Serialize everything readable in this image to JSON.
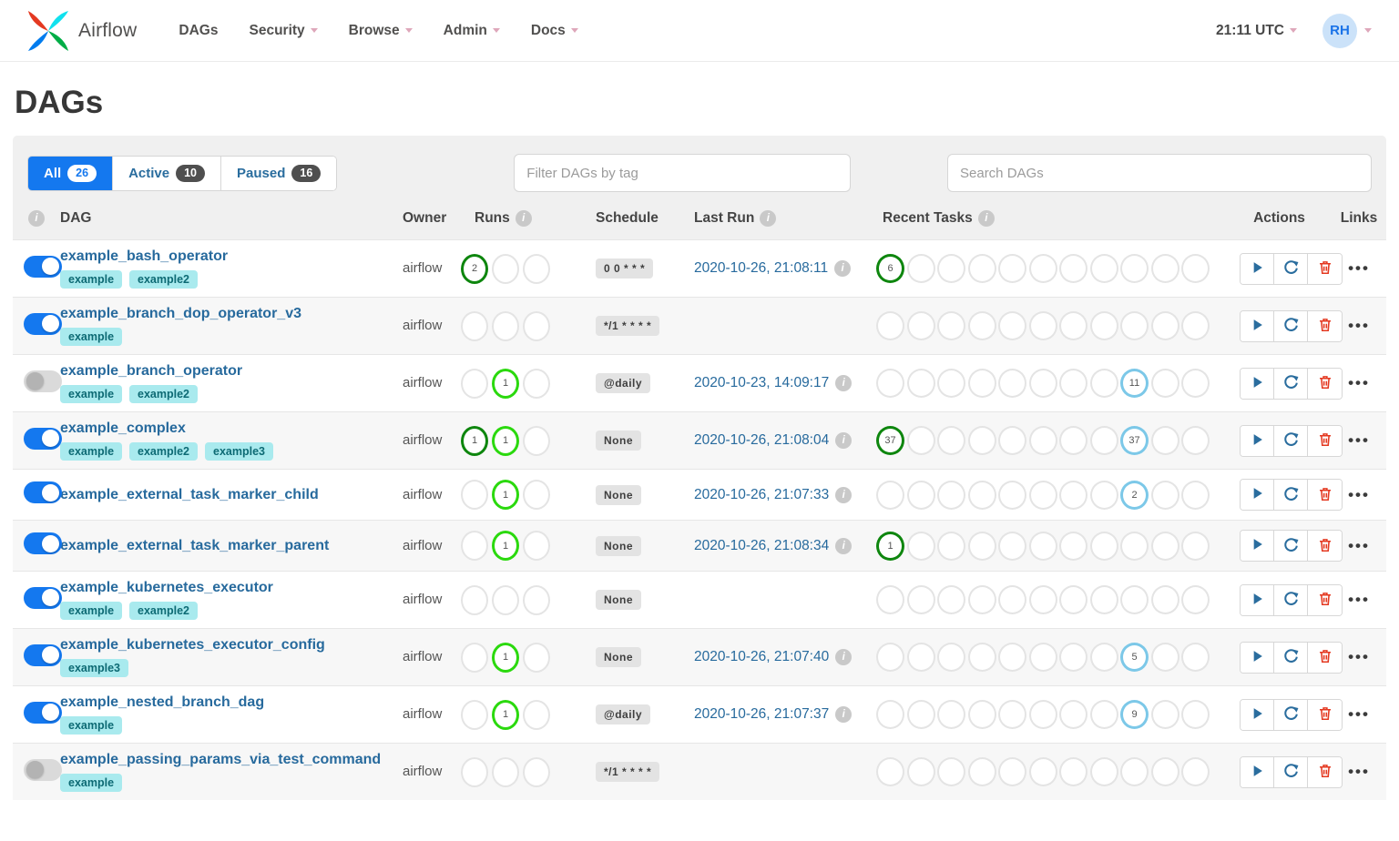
{
  "navbar": {
    "brand": "Airflow",
    "items": [
      {
        "label": "DAGs",
        "caret": false
      },
      {
        "label": "Security",
        "caret": true
      },
      {
        "label": "Browse",
        "caret": true
      },
      {
        "label": "Admin",
        "caret": true
      },
      {
        "label": "Docs",
        "caret": true
      }
    ],
    "clock": "21:11 UTC",
    "avatar_initials": "RH"
  },
  "page": {
    "title": "DAGs"
  },
  "filters": {
    "tabs": [
      {
        "label": "All",
        "count": "26",
        "active": true
      },
      {
        "label": "Active",
        "count": "10",
        "active": false
      },
      {
        "label": "Paused",
        "count": "16",
        "active": false
      }
    ],
    "tag_filter_placeholder": "Filter DAGs by tag",
    "search_placeholder": "Search DAGs"
  },
  "table": {
    "headers": {
      "dag": "DAG",
      "owner": "Owner",
      "runs": "Runs",
      "schedule": "Schedule",
      "last_run": "Last Run",
      "recent_tasks": "Recent Tasks",
      "actions": "Actions",
      "links": "Links"
    },
    "info_glyph": "i",
    "links_glyph": "•••",
    "runs_slots": 3,
    "recent_slots": 11,
    "state_colors": {
      "success": "#0e860e",
      "running": "#2bd90e",
      "none": "#7cc8e8",
      "empty": "#e4e4e4"
    },
    "rows": [
      {
        "name": "example_bash_operator",
        "enabled": true,
        "tags": [
          "example",
          "example2"
        ],
        "owner": "airflow",
        "runs": [
          {
            "slot": 1,
            "count": "2",
            "state": "success"
          }
        ],
        "schedule": "0 0 * * *",
        "last_run": "2020-10-26, 21:08:11",
        "recent": [
          {
            "slot": 1,
            "count": "6",
            "state": "success"
          }
        ]
      },
      {
        "name": "example_branch_dop_operator_v3",
        "enabled": true,
        "tags": [
          "example"
        ],
        "owner": "airflow",
        "runs": [],
        "schedule": "*/1 * * * *",
        "last_run": "",
        "recent": []
      },
      {
        "name": "example_branch_operator",
        "enabled": false,
        "tags": [
          "example",
          "example2"
        ],
        "owner": "airflow",
        "runs": [
          {
            "slot": 2,
            "count": "1",
            "state": "running"
          }
        ],
        "schedule": "@daily",
        "last_run": "2020-10-23, 14:09:17",
        "recent": [
          {
            "slot": 9,
            "count": "11",
            "state": "none"
          }
        ]
      },
      {
        "name": "example_complex",
        "enabled": true,
        "tags": [
          "example",
          "example2",
          "example3"
        ],
        "owner": "airflow",
        "runs": [
          {
            "slot": 1,
            "count": "1",
            "state": "success"
          },
          {
            "slot": 2,
            "count": "1",
            "state": "running"
          }
        ],
        "schedule": "None",
        "last_run": "2020-10-26, 21:08:04",
        "recent": [
          {
            "slot": 1,
            "count": "37",
            "state": "success"
          },
          {
            "slot": 9,
            "count": "37",
            "state": "none"
          }
        ]
      },
      {
        "name": "example_external_task_marker_child",
        "enabled": true,
        "tags": [],
        "owner": "airflow",
        "runs": [
          {
            "slot": 2,
            "count": "1",
            "state": "running"
          }
        ],
        "schedule": "None",
        "last_run": "2020-10-26, 21:07:33",
        "recent": [
          {
            "slot": 9,
            "count": "2",
            "state": "none"
          }
        ]
      },
      {
        "name": "example_external_task_marker_parent",
        "enabled": true,
        "tags": [],
        "owner": "airflow",
        "runs": [
          {
            "slot": 2,
            "count": "1",
            "state": "running"
          }
        ],
        "schedule": "None",
        "last_run": "2020-10-26, 21:08:34",
        "recent": [
          {
            "slot": 1,
            "count": "1",
            "state": "success"
          }
        ]
      },
      {
        "name": "example_kubernetes_executor",
        "enabled": true,
        "tags": [
          "example",
          "example2"
        ],
        "owner": "airflow",
        "runs": [],
        "schedule": "None",
        "last_run": "",
        "recent": []
      },
      {
        "name": "example_kubernetes_executor_config",
        "enabled": true,
        "tags": [
          "example3"
        ],
        "owner": "airflow",
        "runs": [
          {
            "slot": 2,
            "count": "1",
            "state": "running"
          }
        ],
        "schedule": "None",
        "last_run": "2020-10-26, 21:07:40",
        "recent": [
          {
            "slot": 9,
            "count": "5",
            "state": "none"
          }
        ]
      },
      {
        "name": "example_nested_branch_dag",
        "enabled": true,
        "tags": [
          "example"
        ],
        "owner": "airflow",
        "runs": [
          {
            "slot": 2,
            "count": "1",
            "state": "running"
          }
        ],
        "schedule": "@daily",
        "last_run": "2020-10-26, 21:07:37",
        "recent": [
          {
            "slot": 9,
            "count": "9",
            "state": "none"
          }
        ]
      },
      {
        "name": "example_passing_params_via_test_command",
        "enabled": false,
        "tags": [
          "example"
        ],
        "owner": "airflow",
        "runs": [],
        "schedule": "*/1 * * * *",
        "last_run": "",
        "recent": []
      }
    ]
  }
}
